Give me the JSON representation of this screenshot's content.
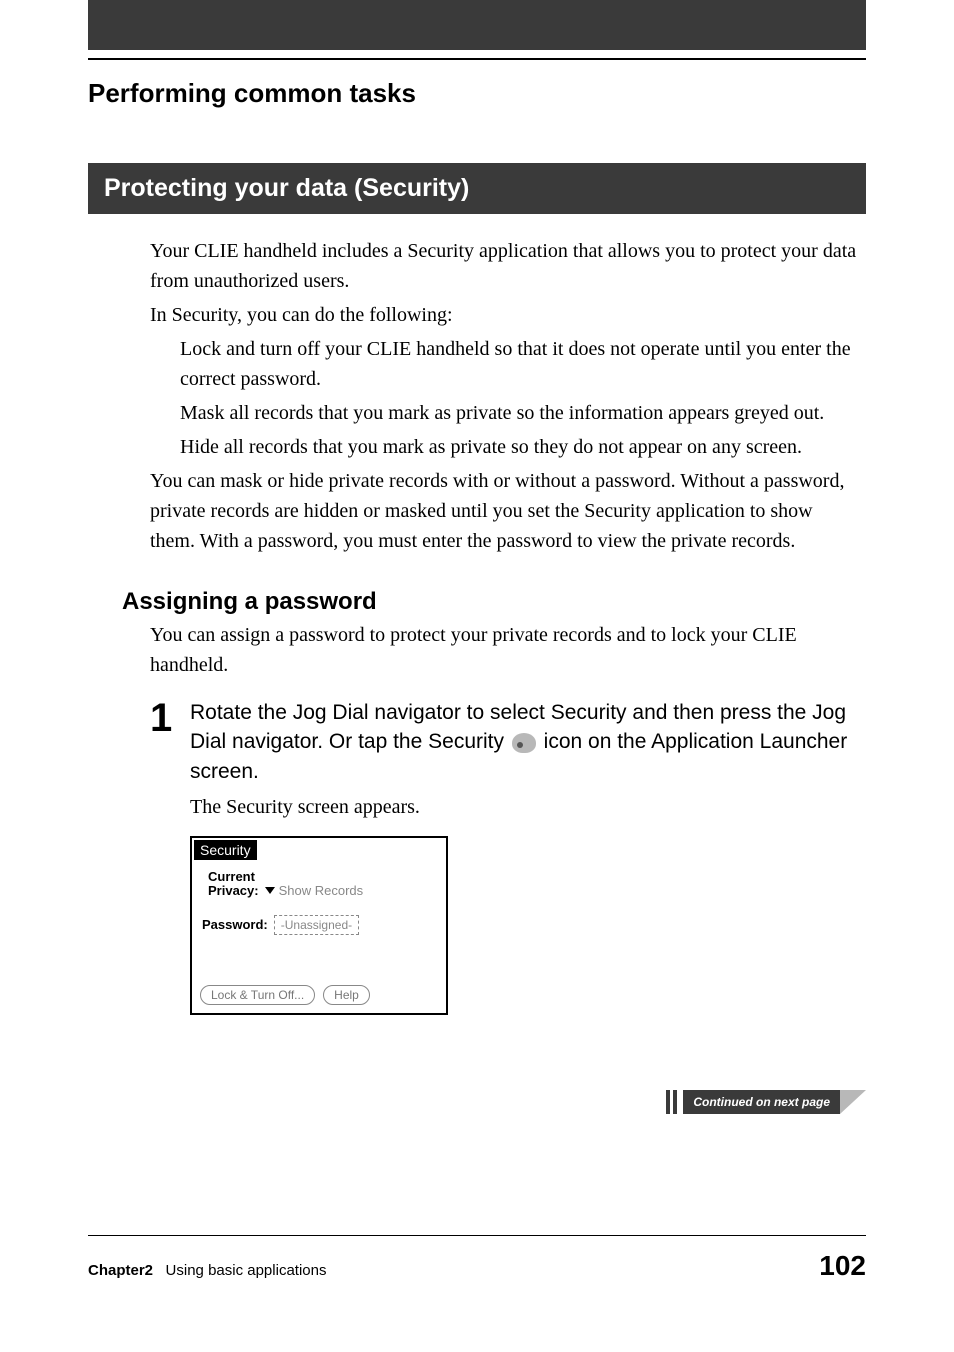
{
  "page_title": "Performing common tasks",
  "section_heading": "Protecting your data (Security)",
  "intro_p1": "Your CLIE handheld includes a Security application that allows you to protect your data from unauthorized users.",
  "intro_p2": "In Security, you can do the following:",
  "bullets": [
    "Lock and turn off your CLIE handheld so that it does not operate until you enter the correct password.",
    "Mask all records that you mark as private so the information appears greyed out.",
    " Hide all records that you mark as private so they do not appear on any screen."
  ],
  "after_bullets": "You can mask or hide private records with or without a password. Without a password, private records are hidden or masked until you set the Security application to show them. With a password, you must enter the password to view the private records.",
  "subheading": "Assigning a password",
  "subheading_body": "You can assign a password to protect your private records and to lock your CLIE handheld.",
  "step": {
    "number": "1",
    "instruction_pre": "Rotate the Jog Dial navigator to select Security and then press the Jog Dial navigator. Or tap the Security ",
    "instruction_post": " icon on the Application Launcher screen.",
    "result": "The Security screen appears."
  },
  "screenshot": {
    "title": "Security",
    "privacy_label_line1": "Current",
    "privacy_label_line2": "Privacy:",
    "privacy_value": "Show Records",
    "password_label": "Password:",
    "password_value": "-Unassigned-",
    "button1": "Lock & Turn Off...",
    "button2": "Help"
  },
  "continued": "Continued on next page",
  "footer": {
    "chapter": "Chapter2",
    "chapter_title": "Using basic applications",
    "page_number": "102"
  }
}
